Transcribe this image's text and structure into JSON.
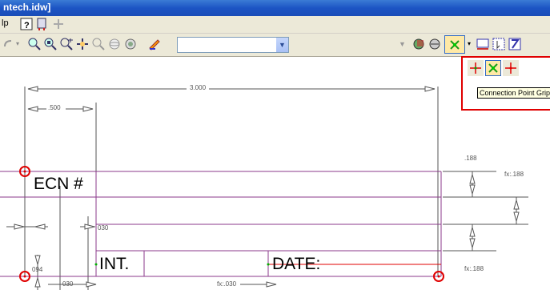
{
  "window": {
    "title": "ntech.idw]"
  },
  "menubar": {
    "help_partial": "lp"
  },
  "toolbar": {
    "style_combo_value": "",
    "buttons": [
      "help-icon",
      "sketch-icon",
      "add-icon",
      "zoom-icon",
      "zoom-window-icon",
      "zoom-all-icon",
      "pan-icon",
      "zoom-selected-icon",
      "orbit-icon",
      "look-at-icon",
      "color-icon",
      "shading-icon",
      "grip-icon",
      "image-icon",
      "select-icon",
      "filter-icon"
    ]
  },
  "popup": {
    "tools": [
      "center-point-grip-icon",
      "connection-point-grip-icon",
      "end-point-grip-icon"
    ],
    "tooltip": "Connection Point Grip"
  },
  "drawing": {
    "dim_overall": "3.000",
    "dim_left": ".500",
    "dim_right_top": ".188",
    "dim_fx_right_top": "fx:.188",
    "dim_fx_right_bottom": "fx:.188",
    "dim_030_mid": "030",
    "dim_094": "094",
    "dim_030_bottom": "030",
    "dim_fx_bottom": "fx:.030",
    "label_ecn": "ECN #",
    "label_int": "INT.",
    "label_date": "DATE:"
  },
  "colors": {
    "title_bar": "#1c54c4",
    "table_lines": "#8b3a8b",
    "highlight_red": "#e00000",
    "grip_green": "#00b000"
  }
}
